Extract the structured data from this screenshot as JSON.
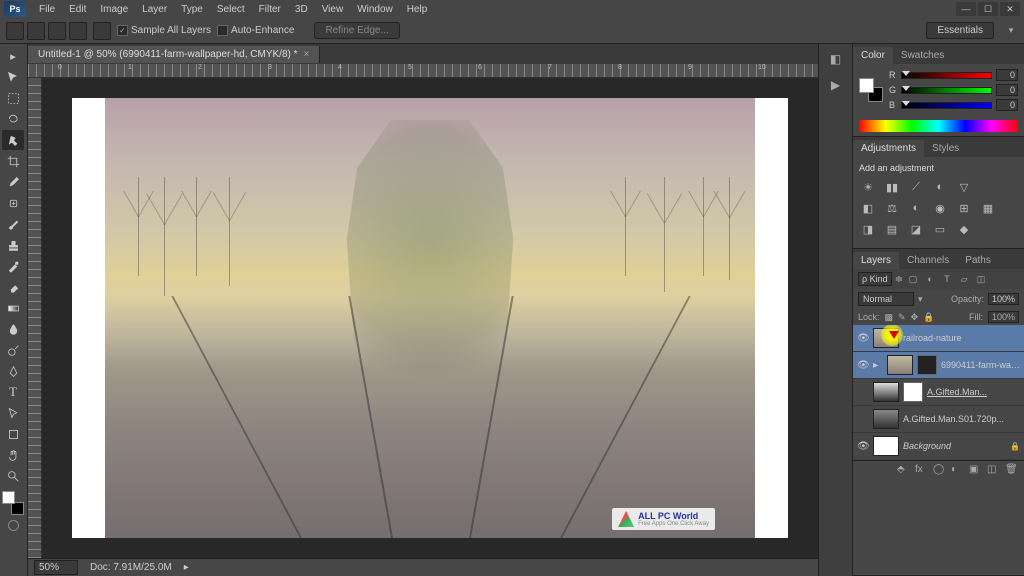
{
  "app": {
    "logo": "Ps"
  },
  "menus": [
    "File",
    "Edit",
    "Image",
    "Layer",
    "Type",
    "Select",
    "Filter",
    "3D",
    "View",
    "Window",
    "Help"
  ],
  "optionsBar": {
    "sampleAll": "Sample All Layers",
    "autoEnhance": "Auto-Enhance",
    "refine": "Refine Edge..."
  },
  "workspace": "Essentials",
  "documentTab": "Untitled-1 @ 50% (6990411-farm-wallpaper-hd, CMYK/8) *",
  "rulerH": [
    "0",
    "1",
    "2",
    "3",
    "4",
    "5",
    "6",
    "7",
    "8",
    "9",
    "10"
  ],
  "statusBar": {
    "zoom": "50%",
    "doc": "Doc: 7.91M/25.0M"
  },
  "watermark": {
    "title": "ALL PC World",
    "sub": "Free Apps One Click Away"
  },
  "panels": {
    "color": {
      "tabs": [
        "Color",
        "Swatches"
      ],
      "channels": [
        {
          "label": "R",
          "value": "0"
        },
        {
          "label": "G",
          "value": "0"
        },
        {
          "label": "B",
          "value": "0"
        }
      ]
    },
    "adjustments": {
      "tabs": [
        "Adjustments",
        "Styles"
      ],
      "title": "Add an adjustment"
    },
    "layers": {
      "tabs": [
        "Layers",
        "Channels",
        "Paths"
      ],
      "kind": "ρ Kind",
      "blend": "Normal",
      "opacityLabel": "Opacity:",
      "opacity": "100%",
      "lockLabel": "Lock:",
      "fillLabel": "Fill:",
      "fill": "100%",
      "items": [
        {
          "name": "railroad-nature"
        },
        {
          "name": "6990411-farm-wallp..."
        },
        {
          "name": "A.Gifted.Man..."
        },
        {
          "name": "A.Gifted.Man.S01.720p..."
        },
        {
          "name": "Background"
        }
      ]
    }
  }
}
